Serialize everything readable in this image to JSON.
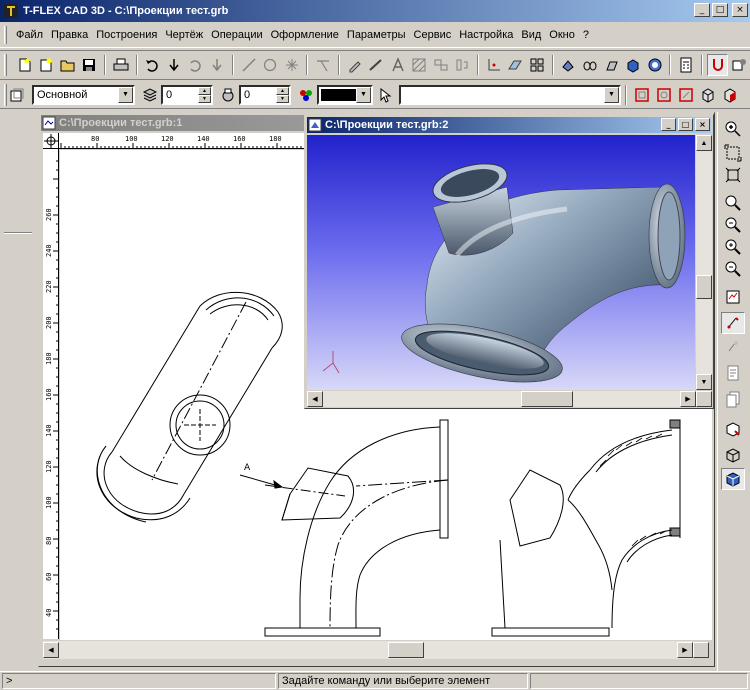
{
  "window": {
    "title": "T-FLEX CAD 3D - C:\\Проекции тест.grb"
  },
  "menu": [
    "Файл",
    "Правка",
    "Построения",
    "Чертёж",
    "Операции",
    "Оформление",
    "Параметры",
    "Сервис",
    "Настройка",
    "Вид",
    "Окно",
    "?"
  ],
  "toolbar2": {
    "layer_value": "Основной",
    "level_value": "0",
    "priority_value": "0",
    "color_value": "#000000"
  },
  "windows": {
    "drawing": {
      "title": "C:\\Проекции тест.grb:1",
      "ruler_ticks": [
        "80",
        "100",
        "120",
        "140",
        "160",
        "180"
      ],
      "vruler_ticks": [
        "260",
        "240",
        "220",
        "200",
        "180",
        "160",
        "140",
        "120",
        "100",
        "80",
        "60",
        "40"
      ],
      "section_label": "A"
    },
    "model3d": {
      "title": "C:\\Проекции тест.grb:2"
    }
  },
  "status": {
    "left": ">",
    "message": "Задайте команду или выберите элемент"
  },
  "colors": {
    "title_start": "#0a246a",
    "title_end": "#a6caf0",
    "viewport_top": "#2222cc",
    "viewport_bottom": "#d8d8f8"
  }
}
